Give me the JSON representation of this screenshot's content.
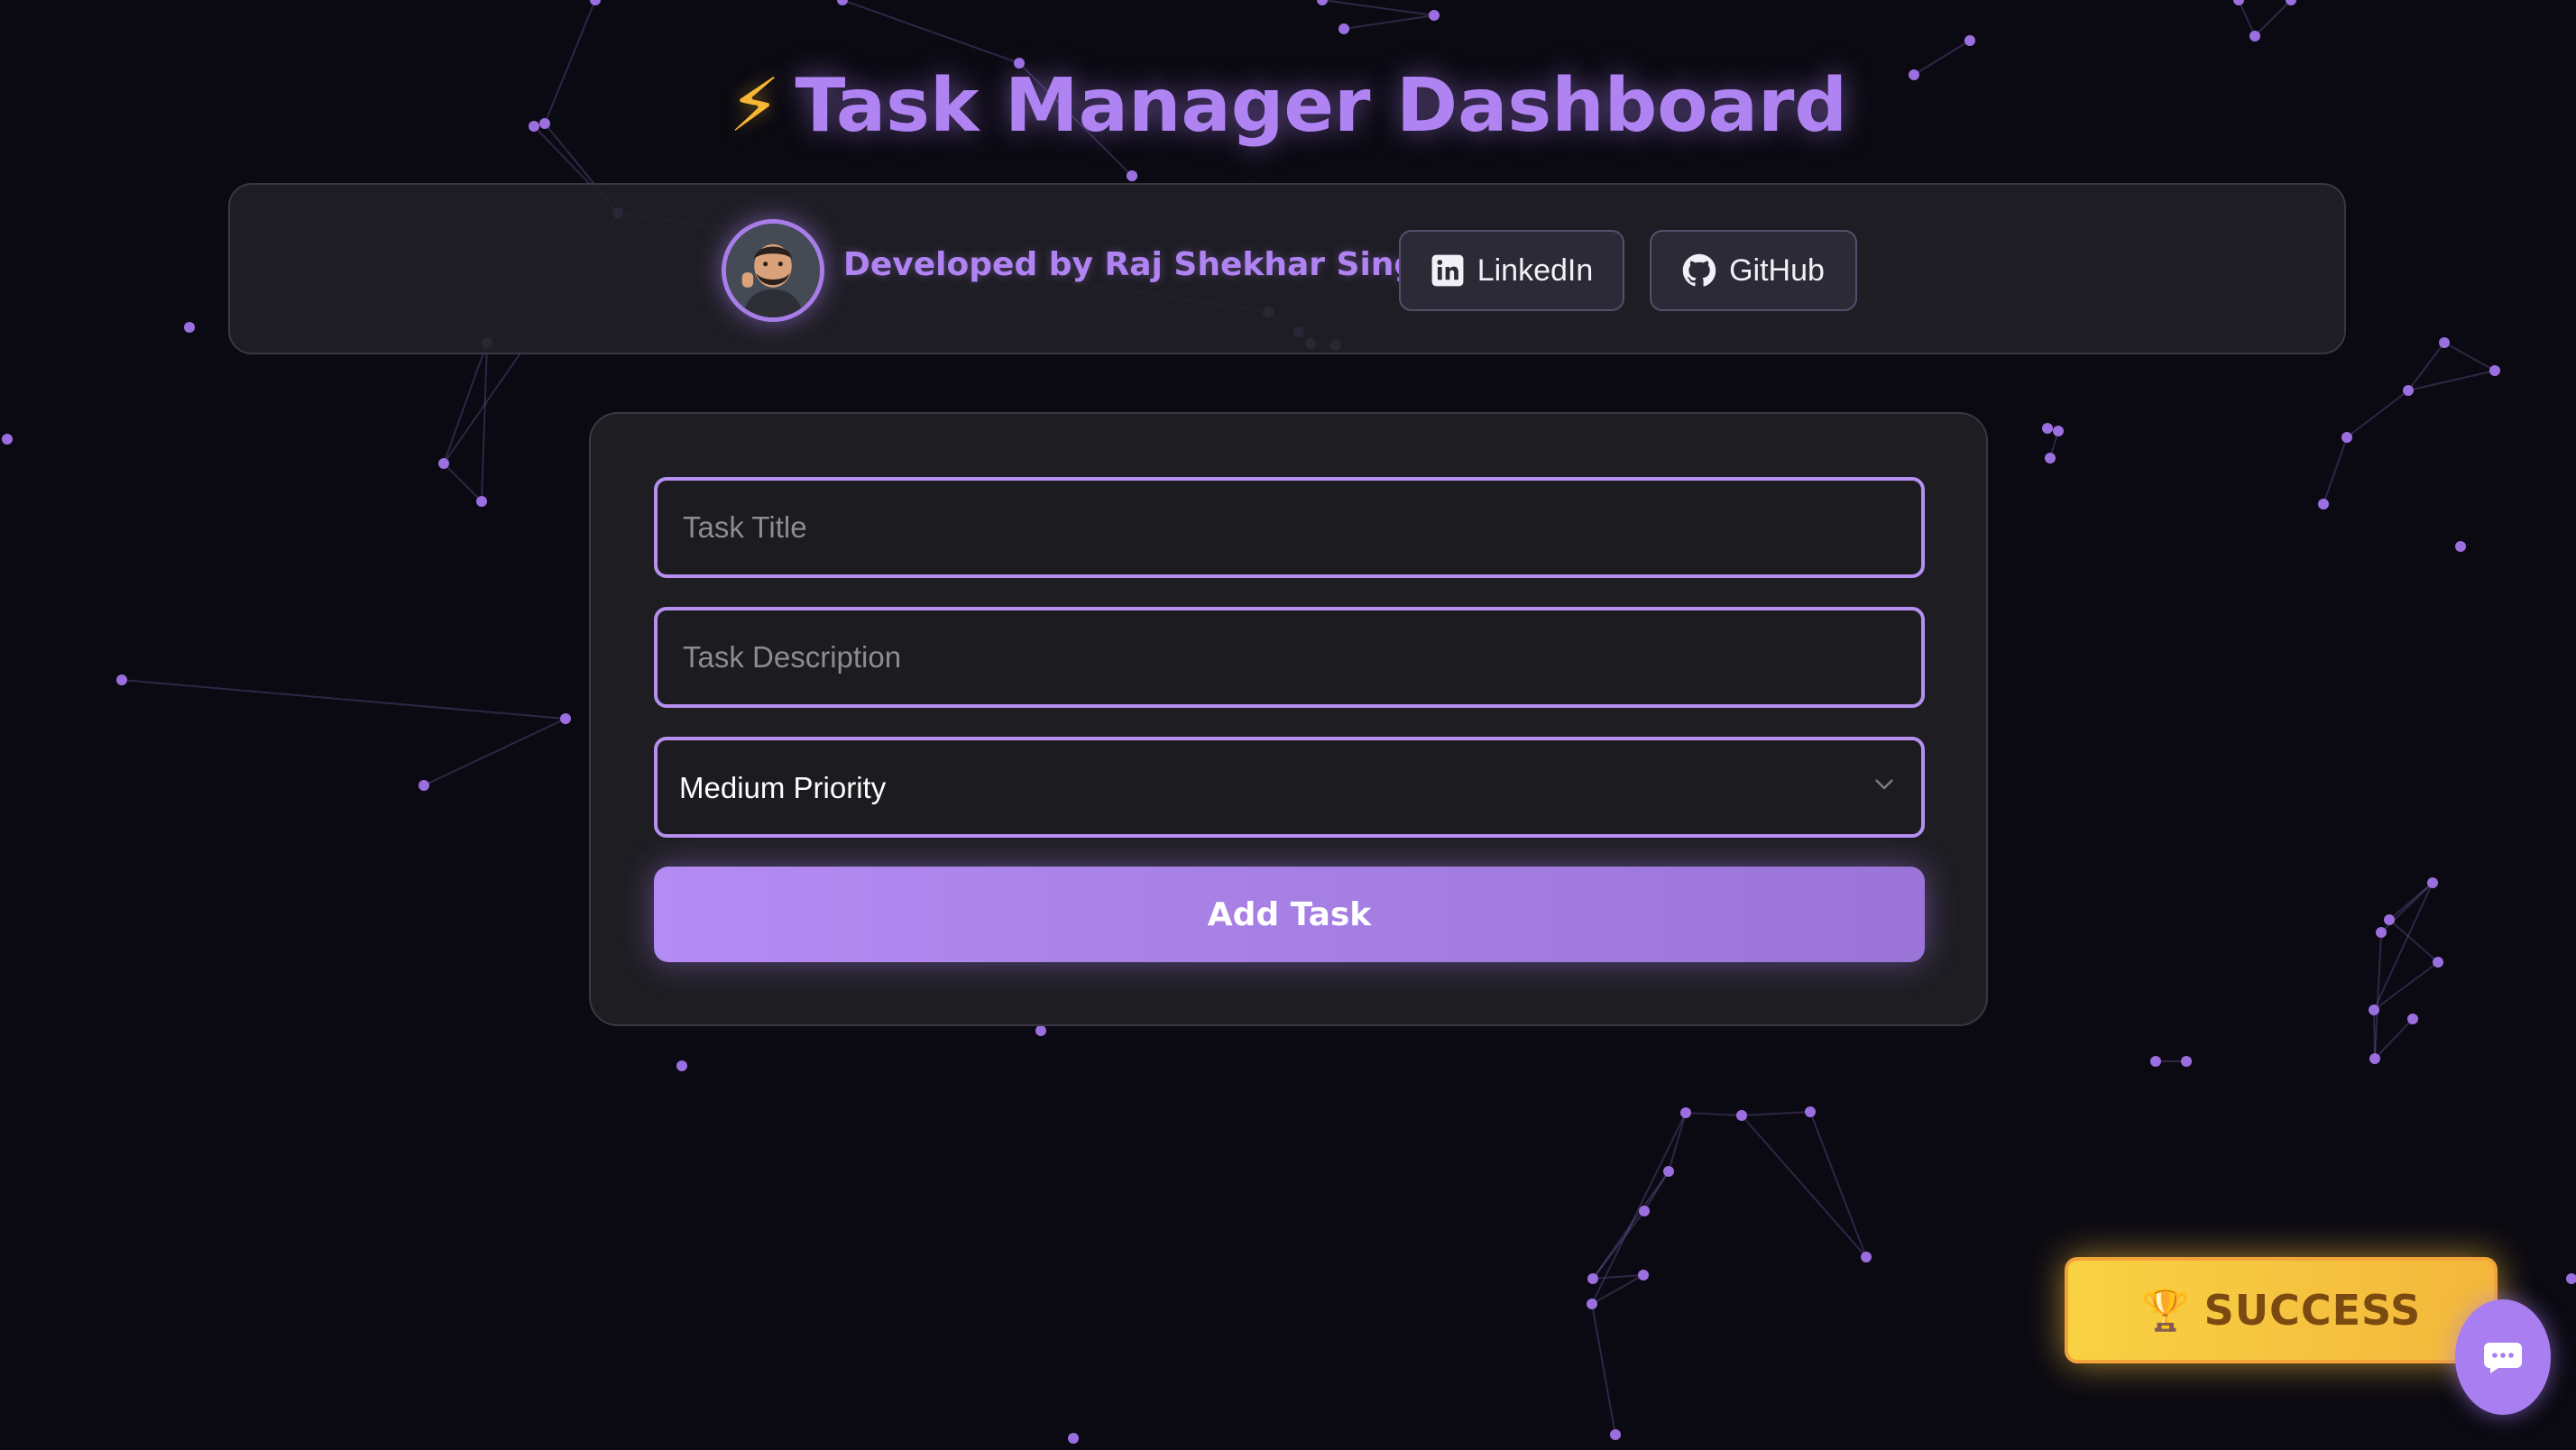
{
  "header": {
    "title_icon": "⚡",
    "title": "Task Manager Dashboard"
  },
  "developer_bar": {
    "avatar_icon": "memoji-avatar",
    "credit_text": "Developed by Raj Shekhar Singh",
    "linkedin_label": "LinkedIn",
    "linkedin_icon": "linkedin-icon",
    "github_label": "GitHub",
    "github_icon": "github-icon"
  },
  "task_form": {
    "title_placeholder": "Task Title",
    "title_value": "",
    "description_placeholder": "Task Description",
    "description_value": "",
    "priority_selected": "Medium Priority",
    "add_button_label": "Add Task"
  },
  "badge": {
    "trophy_icon": "🏆",
    "label": "SUCCESS"
  },
  "chat": {
    "icon": "chat-bubble-icon"
  },
  "colors": {
    "background": "#0b0a12",
    "accent": "#b083f3",
    "card": "#1e1d22",
    "badge_gold": "#f8d243"
  }
}
